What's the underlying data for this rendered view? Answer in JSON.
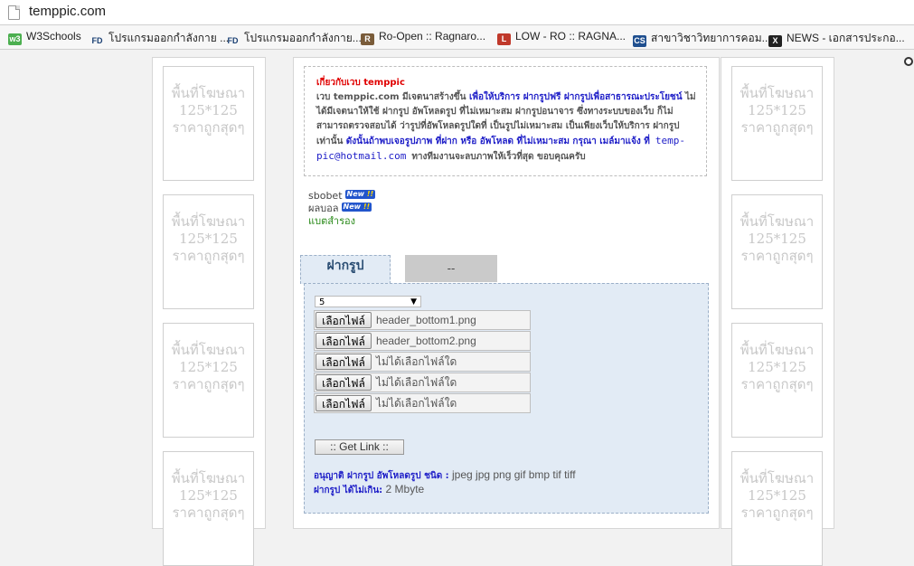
{
  "browser": {
    "url": "temppic.com",
    "bookmarks": [
      {
        "icon": "w3schools-icon",
        "label": "W3Schools",
        "color": "#4caf50",
        "glyph": "w3"
      },
      {
        "icon": "fd-icon",
        "label": "โปรแกรมออกกำลังกาย ...",
        "color": "#1a3f73",
        "glyph": "FD"
      },
      {
        "icon": "fd-icon",
        "label": "โปรแกรมออกกำลังกาย...",
        "color": "#1a3f73",
        "glyph": "FD"
      },
      {
        "icon": "ro-open-icon",
        "label": "Ro-Open :: Ragnaro...",
        "color": "#7a5c3a",
        "glyph": "R"
      },
      {
        "icon": "low-ro-icon",
        "label": "LOW - RO :: RAGNA...",
        "color": "#c0392b",
        "glyph": "L"
      },
      {
        "icon": "cs-icon",
        "label": "สาขาวิชาวิทยาการคอม...",
        "color": "#1f4f8f",
        "glyph": "CS"
      },
      {
        "icon": "news-icon",
        "label": "NEWS - เอกสารประกอ...",
        "color": "#222222",
        "glyph": "X"
      }
    ]
  },
  "ads": {
    "line1": "พื้นที่โฆษณา",
    "line2": "125*125",
    "line3": "ราคาถูกสุดๆ"
  },
  "about": {
    "heading": "เกี่ยวกับเวบ temppic",
    "p1": "เวบ temppic.com มีเจตนาสร้างขึ้น ",
    "p1_blue": "เพื่อให้บริการ ฝากรูปฟรี ฝากรูปเพื่อสาธารณะประโยชน์",
    "p2": " ไม่ได้มีเจตนาให้ใช้ ฝากรูป อัพโหลดรูป ที่ไม่เหมาะสม ฝากรูปอนาจาร ซึ่งทางระบบของเว็บ ก็ไม่สามารถตรวจสอบได้ ว่ารูปที่อัพโหลดรูปใดที่ เป็นรูปไม่เหมาะสม เป็นเพียงเว็บให้บริการ ฝากรูป เท่านั้น ",
    "p2_blue": "ดังนั้นถ้าพบเจอรูปภาพ ที่ฝาก หรือ อัพโหลด ที่ไม่เหมาะสม กรุณา เมล์มาแจ้ง ที่",
    "email": "temp-pic@hotmail.com",
    "p3": "ทางทีมงานจะลบภาพให้เร็วที่สุด ขอบคุณครับ"
  },
  "links": {
    "item1": "sbobet",
    "item2": "ผลบอล",
    "item3": "แบตสำรอง",
    "badge": "New",
    "badge_ex": "!!"
  },
  "tabs": {
    "active": "ฝากรูป",
    "inactive": "--"
  },
  "upload": {
    "count_value": "5",
    "choose_label": "เลือกไฟล์",
    "files": [
      "header_bottom1.png",
      "header_bottom2.png",
      "ไม่ได้เลือกไฟล์ใด",
      "ไม่ได้เลือกไฟล์ใด",
      "ไม่ได้เลือกไฟล์ใด"
    ],
    "get_link": ":: Get Link ::",
    "allowed_label": "อนุญาติ ฝากรูป อัพโหลดรูป ชนิด :",
    "allowed_types": " jpeg jpg png gif bmp tif tiff",
    "max_label": "ฝากรูป ได้ไม่เกิน:",
    "max_size": " 2 Mbyte"
  }
}
